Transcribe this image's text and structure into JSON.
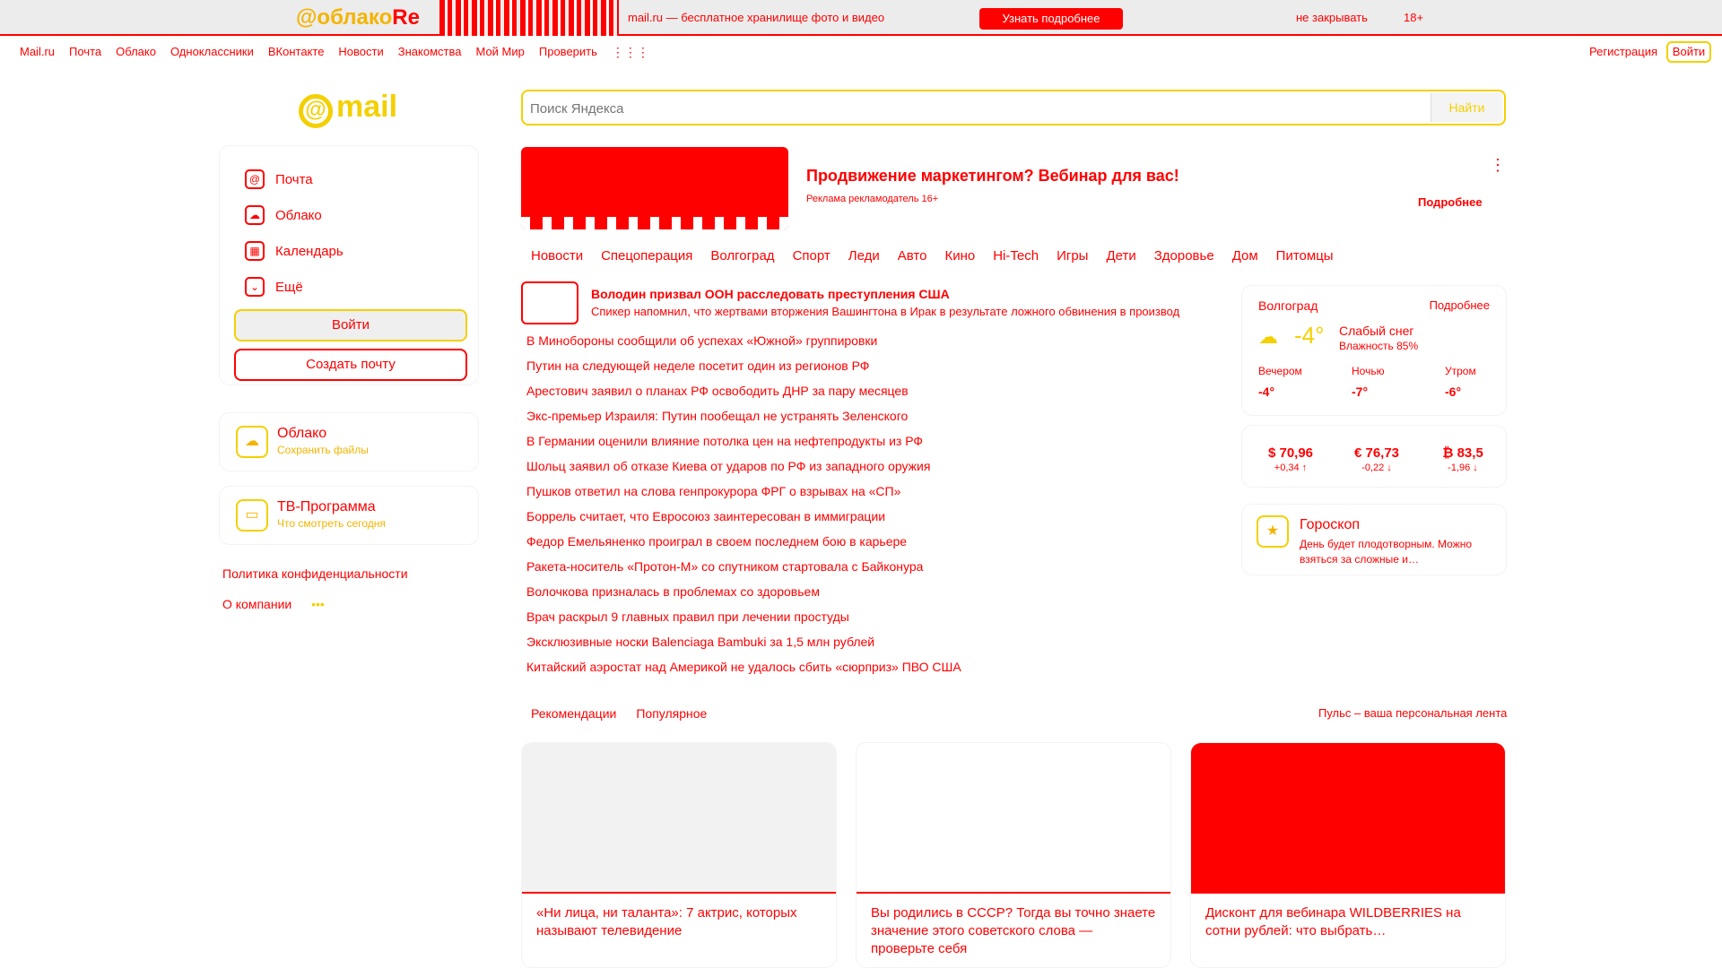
{
  "promo": {
    "logo_a": "@облако",
    "logo_b": "Re",
    "text": "mail.ru — бесплатное хранилище фото и видео",
    "button": "Узнать подробнее",
    "close": "не закрывать",
    "age": "18+"
  },
  "topnav": {
    "links": [
      "Mail.ru",
      "Почта",
      "Облако",
      "Одноклассники",
      "ВКонтакте",
      "Новости",
      "Знакомства",
      "Мой Мир",
      "Проверить"
    ],
    "grid_icon": "grid-icon",
    "register": "Регистрация",
    "login": "Войти"
  },
  "left": {
    "logo": "mail",
    "menu": [
      {
        "label": "Почта",
        "icon": "mail-icon",
        "glyph": "@"
      },
      {
        "label": "Облако",
        "icon": "cloud-icon",
        "glyph": "☁"
      },
      {
        "label": "Календарь",
        "icon": "calendar-icon",
        "glyph": "▦"
      },
      {
        "label": "Ещё",
        "icon": "chevron-down-icon",
        "glyph": "⌄"
      }
    ],
    "login_button": "Войти",
    "create_button": "Создать почту",
    "cloud_card": {
      "title": "Облако",
      "subtitle": "Сохранить файлы"
    },
    "tv_card": {
      "title": "ТВ-Программа",
      "subtitle": "Что смотреть сегодня"
    },
    "privacy": "Политика конфиденциальности",
    "about": "О компании",
    "more_dots": "•••"
  },
  "search": {
    "placeholder": "Поиск Яндекса",
    "button": "Найти"
  },
  "ad": {
    "title": "Продвижение маркетингом? Вебинар для вас!",
    "subtitle": "Реклама рекламодатель 16+",
    "more": "Подробнее",
    "dots": "⋮"
  },
  "categories": [
    "Новости",
    "Спецоперация",
    "Волгоград",
    "Спорт",
    "Леди",
    "Авто",
    "Кино",
    "Hi-Tech",
    "Игры",
    "Дети",
    "Здоровье",
    "Дом",
    "Питомцы"
  ],
  "lead": {
    "headline": "Володин призвал ООН расследовать преступления США",
    "subline": "Спикер напомнил, что жертвами вторжения Вашингтона в Ирак в результате ложного обвинения в производ"
  },
  "news": [
    "В Минобороны сообщили об успехах «Южной» группировки",
    "Путин на следующей неделе посетит один из регионов РФ",
    "Арестович заявил о планах РФ освободить ДНР за пару месяцев",
    "Экс-премьер Израиля: Путин пообещал не устранять Зеленского",
    "В Германии оценили влияние потолка цен на нефтепродукты из РФ",
    "Шольц заявил об отказе Киева от ударов по РФ из западного оружия",
    "Пушков ответил на слова генпрокурора ФРГ о взрывах на «СП»",
    "Боррель считает, что Евросоюз заинтересован в иммиграции",
    "Федор Емельяненко проиграл в своем последнем бою в карьере",
    "Ракета-носитель «Протон-М» со спутником стартовала с Байконура",
    "Волочкова призналась в проблемах со здоровьем",
    "Врач раскрыл 9 главных правил при лечении простуды",
    "Эксклюзивные носки Balenciaga Bambuki за 1,5 млн рублей",
    "Китайский аэростат над Америкой не удалось сбить «сюрприз» ПВО США"
  ],
  "weather": {
    "city": "Волгоград",
    "more": "Подробнее",
    "icon": "snow-cloud-icon",
    "now": "-4°",
    "condition": "Слабый снег",
    "humidity": "Влажность 85%",
    "parts": [
      {
        "name": "Вечером",
        "value": "-4°"
      },
      {
        "name": "Ночью",
        "value": "-7°"
      },
      {
        "name": "Утром",
        "value": "-6°"
      }
    ]
  },
  "rates": [
    {
      "value": "$ 70,96",
      "delta": "+0,34 ↑"
    },
    {
      "value": "€ 76,73",
      "delta": "-0,22 ↓"
    },
    {
      "value": "₿ 83,5",
      "delta": "-1,96 ↓"
    }
  ],
  "horoscope": {
    "title": "Гороскоп",
    "text": "День будет плодотворным. Можно взяться за сложные и…",
    "icon": "star-icon"
  },
  "feed": {
    "tabs": [
      "Рекомендации",
      "Популярное"
    ],
    "note": "Пульс – ваша персональная лента",
    "cards": [
      "«Ни лица, ни таланта»: 7 актрис, которых называют телевидение",
      "Вы родились в СССР? Тогда вы точно знаете значение этого советского слова — проверьте себя",
      "Дисконт для вебинара WILDBERRIES на сотни рублей: что выбрать…"
    ]
  },
  "colors": {
    "accent": "#ff0000",
    "yellow": "#f4d000",
    "gray": "#ececec"
  }
}
